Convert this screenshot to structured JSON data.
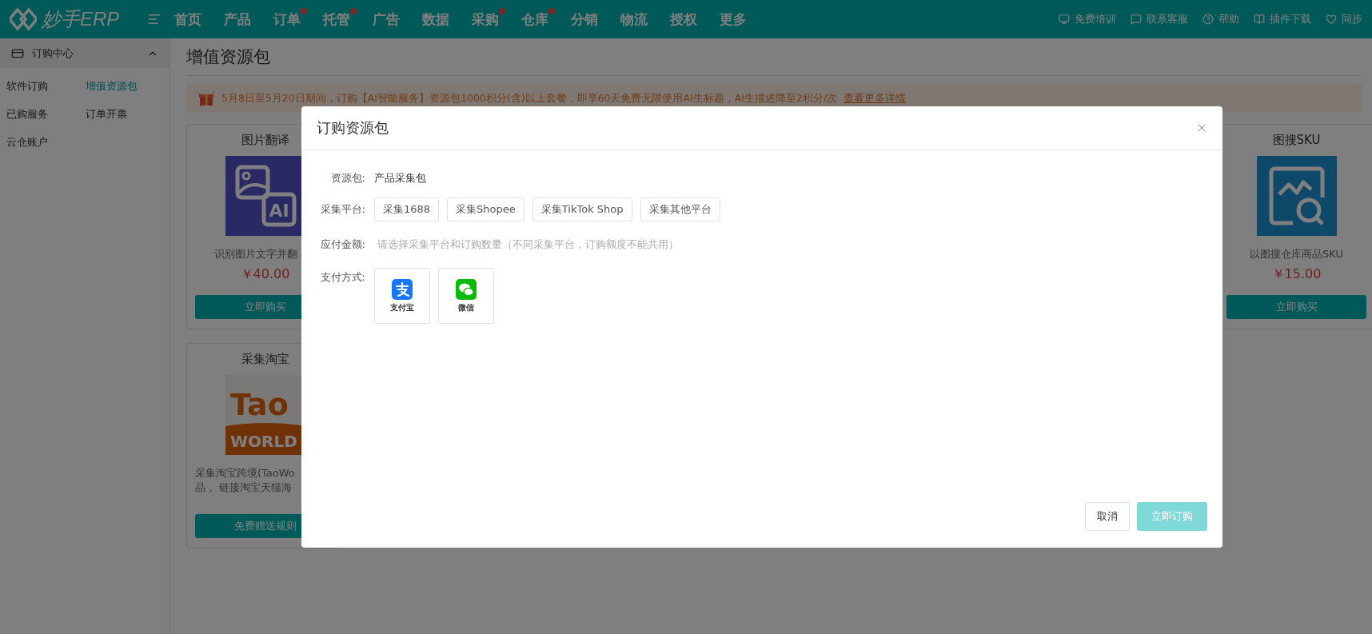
{
  "top_bar": {
    "logo": "妙手ERP",
    "nav": [
      {
        "label": "首页",
        "badge": false
      },
      {
        "label": "产品",
        "badge": false
      },
      {
        "label": "订单",
        "badge": true
      },
      {
        "label": "托管",
        "badge": true
      },
      {
        "label": "广告",
        "badge": false
      },
      {
        "label": "数据",
        "badge": false
      },
      {
        "label": "采购",
        "badge": true
      },
      {
        "label": "仓库",
        "badge": true
      },
      {
        "label": "分销",
        "badge": false
      },
      {
        "label": "物流",
        "badge": false
      },
      {
        "label": "授权",
        "badge": false
      },
      {
        "label": "更多",
        "badge": false
      }
    ],
    "links": [
      {
        "label": "免费培训",
        "kind": "monitor"
      },
      {
        "label": "联系客服",
        "kind": "chat"
      },
      {
        "label": "帮助",
        "kind": "help"
      },
      {
        "label": "插件下载",
        "kind": "book"
      },
      {
        "label": "同步",
        "kind": "heart"
      }
    ]
  },
  "sidebar": {
    "header": "订购中心",
    "expanded": true,
    "items": [
      {
        "label": "软件订购",
        "selected": false
      },
      {
        "label": "增值资源包",
        "selected": true
      },
      {
        "label": "已购服务",
        "selected": false
      },
      {
        "label": "订单开票",
        "selected": false
      },
      {
        "label": "云仓账户",
        "selected": false
      }
    ]
  },
  "page": {
    "title": "增值资源包",
    "banner": {
      "text": "5月8日至5月20日期间，订购【AI智能服务】资源包1000积分(含)以上套餐，即享60天免费无限使用AI生标题，AI生描述降至2积分/次",
      "link": "查看更多详情"
    },
    "card_rows": [
      [
        {
          "title": "图片翻译",
          "kind": "translate",
          "image_text": [
            "AI"
          ],
          "desc": "识别图片文字并翻",
          "price": "￥40.00",
          "button": "立即购买"
        },
        {
          "title": "图搜SKU",
          "kind": "search",
          "desc": "以图搜仓库商品SKU",
          "price": "￥15.00",
          "button": "立即购买"
        }
      ],
      [
        {
          "title": "采集淘宝",
          "kind": "logo",
          "image_text": [
            "Tao",
            "WORLD"
          ],
          "desc": "采集淘宝跨境(TaoWo\n品， 链接淘宝天猫海",
          "button": "免费赠送规则"
        }
      ]
    ]
  },
  "modal": {
    "title": "订购资源包",
    "fields": [
      {
        "label": "资源包:",
        "kind": "text",
        "value": "产品采集包"
      },
      {
        "label": "采集平台:",
        "kind": "options",
        "options": [
          {
            "label": "采集1688",
            "selected": false
          },
          {
            "label": "采集Shopee",
            "selected": false
          },
          {
            "label": "采集TikTok Shop",
            "selected": false
          },
          {
            "label": "采集其他平台",
            "selected": false
          }
        ]
      },
      {
        "label": "应付金额:",
        "kind": "hint",
        "value": "请选择采集平台和订购数量（不同采集平台，订购额度不能共用）"
      },
      {
        "label": "支付方式:",
        "kind": "payment",
        "options": [
          {
            "label": "支付宝",
            "kind": "alipay",
            "selected": false
          },
          {
            "label": "微信",
            "kind": "wechat",
            "selected": false
          }
        ]
      }
    ],
    "cancel": "取消",
    "submit": {
      "label": "立即订购",
      "disabled": true
    }
  }
}
